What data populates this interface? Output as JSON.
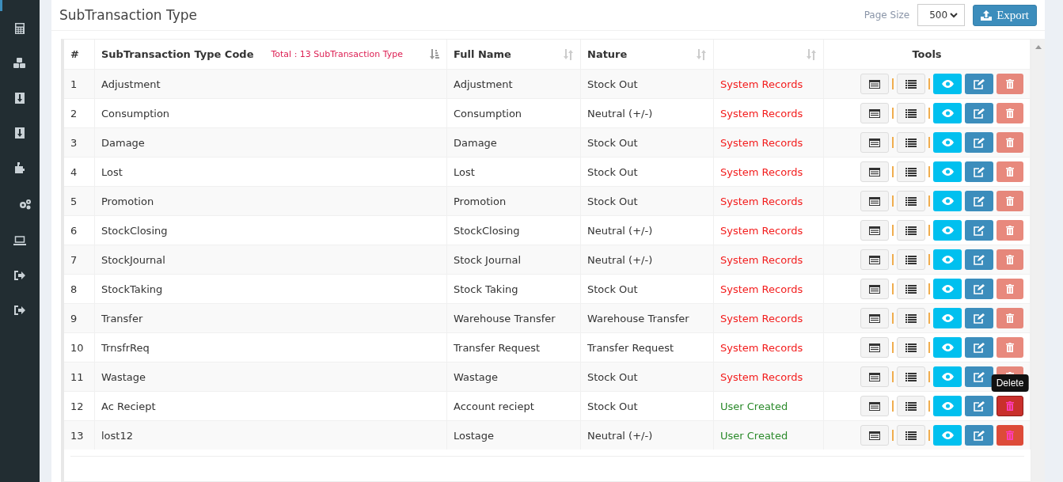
{
  "page_title": "SubTransaction Type",
  "page_size": {
    "label": "Page Size",
    "value": "500"
  },
  "export_button": "Export",
  "table": {
    "columns": [
      {
        "label": "#",
        "kind": "plain"
      },
      {
        "label": "SubTransaction Type Code",
        "kind": "sorted",
        "note": "Total : 13 SubTransaction Type"
      },
      {
        "label": "Full Name",
        "kind": "sortable"
      },
      {
        "label": "Nature",
        "kind": "sortable"
      },
      {
        "kind": "sortable"
      },
      {
        "label": "Tools",
        "kind": "plain"
      }
    ],
    "rows": [
      {
        "no": "1",
        "code": "Adjustment",
        "full_name": "Adjustment",
        "nature": "Stock Out",
        "source": "System Records",
        "kind": "system",
        "delete_enabled": false,
        "hovered": false
      },
      {
        "no": "2",
        "code": "Consumption",
        "full_name": "Consumption",
        "nature": "Neutral (+/-)",
        "source": "System Records",
        "kind": "system",
        "delete_enabled": false,
        "hovered": false
      },
      {
        "no": "3",
        "code": "Damage",
        "full_name": "Damage",
        "nature": "Stock Out",
        "source": "System Records",
        "kind": "system",
        "delete_enabled": false,
        "hovered": false
      },
      {
        "no": "4",
        "code": "Lost",
        "full_name": "Lost",
        "nature": "Stock Out",
        "source": "System Records",
        "kind": "system",
        "delete_enabled": false,
        "hovered": false
      },
      {
        "no": "5",
        "code": "Promotion",
        "full_name": "Promotion",
        "nature": "Stock Out",
        "source": "System Records",
        "kind": "system",
        "delete_enabled": false,
        "hovered": false
      },
      {
        "no": "6",
        "code": "StockClosing",
        "full_name": "StockClosing",
        "nature": "Neutral (+/-)",
        "source": "System Records",
        "kind": "system",
        "delete_enabled": false,
        "hovered": false
      },
      {
        "no": "7",
        "code": "StockJournal",
        "full_name": "Stock Journal",
        "nature": "Neutral (+/-)",
        "source": "System Records",
        "kind": "system",
        "delete_enabled": false,
        "hovered": false
      },
      {
        "no": "8",
        "code": "StockTaking",
        "full_name": "Stock Taking",
        "nature": "Stock Out",
        "source": "System Records",
        "kind": "system",
        "delete_enabled": false,
        "hovered": false
      },
      {
        "no": "9",
        "code": "Transfer",
        "full_name": "Warehouse Transfer",
        "nature": "Warehouse Transfer",
        "source": "System Records",
        "kind": "system",
        "delete_enabled": false,
        "hovered": false
      },
      {
        "no": "10",
        "code": "TrnsfrReq",
        "full_name": "Transfer Request",
        "nature": "Transfer Request",
        "source": "System Records",
        "kind": "system",
        "delete_enabled": false,
        "hovered": false
      },
      {
        "no": "11",
        "code": "Wastage",
        "full_name": "Wastage",
        "nature": "Stock Out",
        "source": "System Records",
        "kind": "system",
        "delete_enabled": false,
        "hovered": false
      },
      {
        "no": "12",
        "code": "Ac Reciept",
        "full_name": "Account reciept",
        "nature": "Stock Out",
        "source": "User Created",
        "kind": "user",
        "delete_enabled": true,
        "hovered": true
      },
      {
        "no": "13",
        "code": "lost12",
        "full_name": "Lostage",
        "nature": "Neutral (+/-)",
        "source": "User Created",
        "kind": "user",
        "delete_enabled": true,
        "hovered": false
      }
    ]
  },
  "tooltip": "Delete"
}
